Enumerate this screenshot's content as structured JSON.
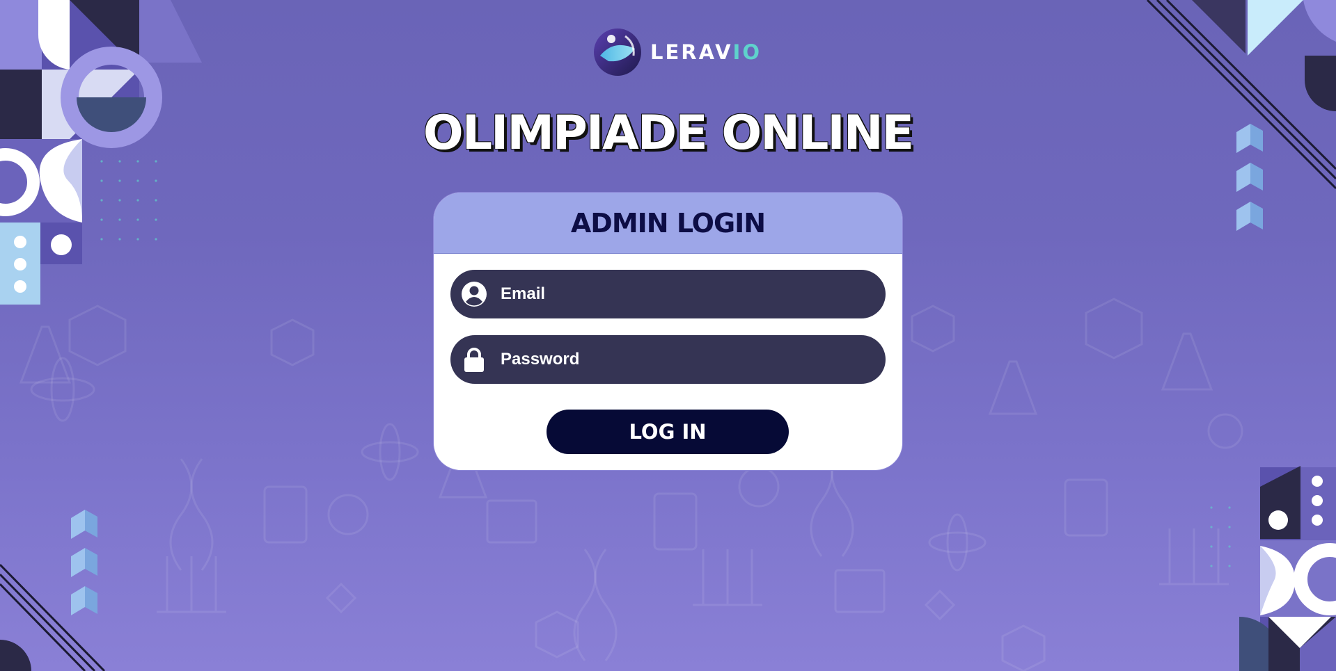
{
  "brand": {
    "name_main": "LERAV",
    "name_accent": "IO",
    "logo_icon": "leravio-logo-icon"
  },
  "title": "OLIMPIADE ONLINE",
  "login_card": {
    "heading": "ADMIN LOGIN",
    "email": {
      "placeholder": "Email",
      "value": "",
      "icon": "user-icon"
    },
    "password": {
      "placeholder": "Password",
      "value": "",
      "icon": "lock-icon"
    },
    "submit_label": "LOG IN"
  },
  "colors": {
    "background": "#6f68bd",
    "card_header": "#9da6e8",
    "field_background": "#353454",
    "button_background": "#060a36",
    "heading_text": "#0d0d45",
    "brand_accent": "#5fd2cc"
  }
}
